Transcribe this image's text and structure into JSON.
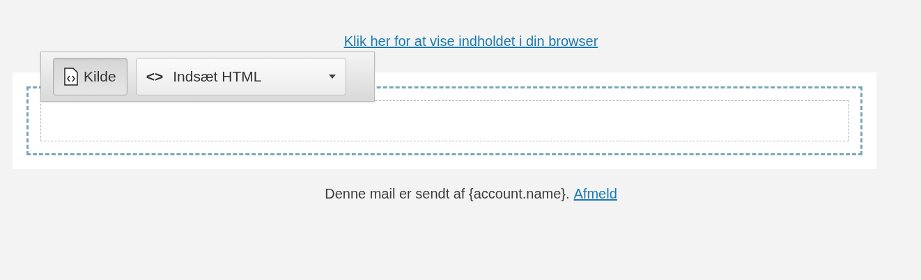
{
  "header_link": "Klik her for at vise indholdet i din browser",
  "toolbar": {
    "source_button": {
      "label": "Kilde",
      "selected": true
    },
    "insert_dropdown": {
      "icon": "<>",
      "label": "Indsæt HTML"
    }
  },
  "footer": {
    "text": "Denne mail er sendt af {account.name}.",
    "link": "Afmeld"
  }
}
